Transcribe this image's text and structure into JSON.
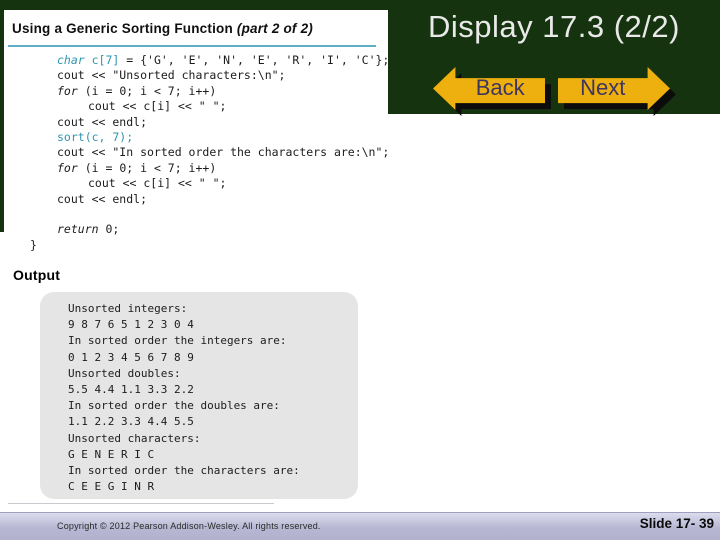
{
  "slide": {
    "title": "Display 17.3 (2/2)",
    "slide_number": "Slide 17- 39",
    "copyright": "Copyright © 2012 Pearson Addison-Wesley. All rights reserved."
  },
  "nav": {
    "back_label": "Back",
    "next_label": "Next"
  },
  "book_page": {
    "heading": "Using a Generic Sorting Function ",
    "heading_part": "(part 2 of 2)",
    "output_label": "Output",
    "code": {
      "lines": [
        {
          "ind": 1,
          "segs": [
            {
              "t": "char",
              "s": "hk"
            },
            {
              "t": " c[7]",
              "s": "h"
            },
            {
              "t": " = {'G', 'E', 'N', 'E', 'R', 'I', 'C'};",
              "s": "p"
            }
          ]
        },
        {
          "ind": 1,
          "segs": [
            {
              "t": "cout << \"Unsorted characters:\\n\";",
              "s": "p"
            }
          ]
        },
        {
          "ind": 1,
          "segs": [
            {
              "t": "for",
              "s": "k"
            },
            {
              "t": " (i = 0; i < 7; i++)",
              "s": "p"
            }
          ]
        },
        {
          "ind": 2,
          "segs": [
            {
              "t": "cout << c[i] << \" \";",
              "s": "p"
            }
          ]
        },
        {
          "ind": 1,
          "segs": [
            {
              "t": "cout << endl;",
              "s": "p"
            }
          ]
        },
        {
          "ind": 1,
          "segs": [
            {
              "t": "sort(c, 7);",
              "s": "h"
            }
          ]
        },
        {
          "ind": 1,
          "segs": [
            {
              "t": "cout << \"In sorted order the characters are:\\n\";",
              "s": "p"
            }
          ]
        },
        {
          "ind": 1,
          "segs": [
            {
              "t": "for",
              "s": "k"
            },
            {
              "t": " (i = 0; i < 7; i++)",
              "s": "p"
            }
          ]
        },
        {
          "ind": 2,
          "segs": [
            {
              "t": "cout << c[i] << \" \";",
              "s": "p"
            }
          ]
        },
        {
          "ind": 1,
          "segs": [
            {
              "t": "cout << endl;",
              "s": "p"
            }
          ]
        },
        {
          "ind": 1,
          "segs": []
        },
        {
          "ind": 1,
          "segs": [
            {
              "t": "return",
              "s": "k"
            },
            {
              "t": " 0;",
              "s": "p"
            }
          ]
        },
        {
          "ind": 0,
          "segs": [
            {
              "t": "}",
              "s": "p"
            }
          ]
        }
      ]
    },
    "output_box": {
      "lines": [
        "Unsorted integers:",
        "9 8 7 6 5 1 2 3 0 4",
        "In sorted order the integers are:",
        "0 1 2 3 4 5 6 7 8 9",
        "Unsorted doubles:",
        "5.5 4.4 1.1 3.3 2.2",
        "In sorted order the doubles are:",
        "1.1 2.2 3.3 4.4 5.5",
        "Unsorted characters:",
        "G E N E R I C",
        "In sorted order the characters are:",
        "C E E G I N R"
      ]
    }
  },
  "colors": {
    "green": "#16330f",
    "yellow": "#eeb00e",
    "btntext": "#3f3660",
    "codeteal": "#3095ae",
    "rule": "#5faec2",
    "boxbg": "#e5e5e5"
  }
}
